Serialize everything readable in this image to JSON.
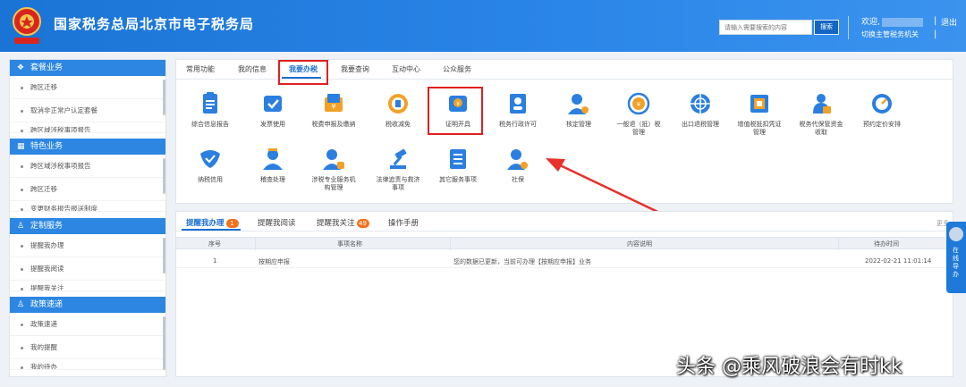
{
  "header": {
    "title": "国家税务总局北京市电子税务局",
    "search_placeholder": "请输入需要搜索的内容",
    "search_label": "搜索",
    "welcome": "欢迎,",
    "switch_link": "切换主管税务机关",
    "logout": "退出",
    "pipe": "|"
  },
  "sidebar": {
    "sections": [
      {
        "title": "套餐业务",
        "items": [
          "跨区迁移",
          "取消非正常户认定套餐",
          "跨区域涉税事项报告"
        ]
      },
      {
        "title": "特色业务",
        "items": [
          "跨区域涉税事项报告",
          "跨区迁移",
          "变更财务报告报送制度"
        ]
      },
      {
        "title": "定制服务",
        "items": [
          "提醒我办理",
          "提醒我阅读",
          "提醒我关注"
        ]
      },
      {
        "title": "政策速递",
        "items": [
          "政策速递",
          "我的提醒",
          "我的待办"
        ]
      }
    ]
  },
  "main_tabs": [
    "常用功能",
    "我的信息",
    "我要办税",
    "我要查询",
    "互动中心",
    "公众服务"
  ],
  "services_row1": [
    {
      "label": "综合信息报告",
      "icon": "clipboard-icon",
      "color": "#2a7fe0"
    },
    {
      "label": "发票使用",
      "icon": "invoice-icon",
      "color": "#2a7fe0"
    },
    {
      "label": "税费申报及缴纳",
      "icon": "wallet-icon",
      "color": "#f2a126"
    },
    {
      "label": "税收减免",
      "icon": "coin-icon",
      "color": "#f2a126"
    },
    {
      "label": "证明开具",
      "icon": "certificate-icon",
      "color": "#2a7fe0"
    },
    {
      "label": "税务行政许可",
      "icon": "badge-person-icon",
      "color": "#2a7fe0"
    },
    {
      "label": "核定管理",
      "icon": "user-gear-icon",
      "color": "#2a7fe0"
    },
    {
      "label": "一般退（抵）税\n管理",
      "icon": "refund-icon",
      "color": "#f2a126"
    },
    {
      "label": "出口退税管理",
      "icon": "globe-icon",
      "color": "#2a7fe0"
    },
    {
      "label": "增值税抵扣凭证\n管理",
      "icon": "voucher-icon",
      "color": "#2a7fe0"
    },
    {
      "label": "税务代保管资金\n收取",
      "icon": "money-bag-icon",
      "color": "#2a7fe0"
    },
    {
      "label": "预约定价安排",
      "icon": "gauge-icon",
      "color": "#f2a126"
    }
  ],
  "services_row2": [
    {
      "label": "纳税信用",
      "icon": "heart-shield-icon",
      "color": "#2a7fe0"
    },
    {
      "label": "稽查处理",
      "icon": "inspector-icon",
      "color": "#2a7fe0"
    },
    {
      "label": "涉税专业服务机\n构管理",
      "icon": "agent-icon",
      "color": "#2a7fe0"
    },
    {
      "label": "法律追责与救济\n事项",
      "icon": "gavel-icon",
      "color": "#2a7fe0"
    },
    {
      "label": "其它服务事项",
      "icon": "list-icon",
      "color": "#2a7fe0"
    },
    {
      "label": "社保",
      "icon": "social-security-icon",
      "color": "#2a7fe0"
    }
  ],
  "reminders": {
    "tabs": [
      {
        "label": "提醒我办理",
        "badge": "1"
      },
      {
        "label": "提醒我阅读",
        "badge": ""
      },
      {
        "label": "提醒我关注",
        "badge": "49"
      },
      {
        "label": "操作手册",
        "badge": ""
      }
    ],
    "more": "更多",
    "columns": [
      "序号",
      "事项名称",
      "内容说明",
      "待办时间"
    ],
    "rows": [
      [
        "1",
        "按期应申报",
        "您的数据已更新，当前可办理【按期应申报】业务",
        "2022-02-21 11:01:14"
      ]
    ]
  },
  "float_guide": {
    "text": "在线导办"
  },
  "watermark": "头条 @乘风破浪会有时kk"
}
